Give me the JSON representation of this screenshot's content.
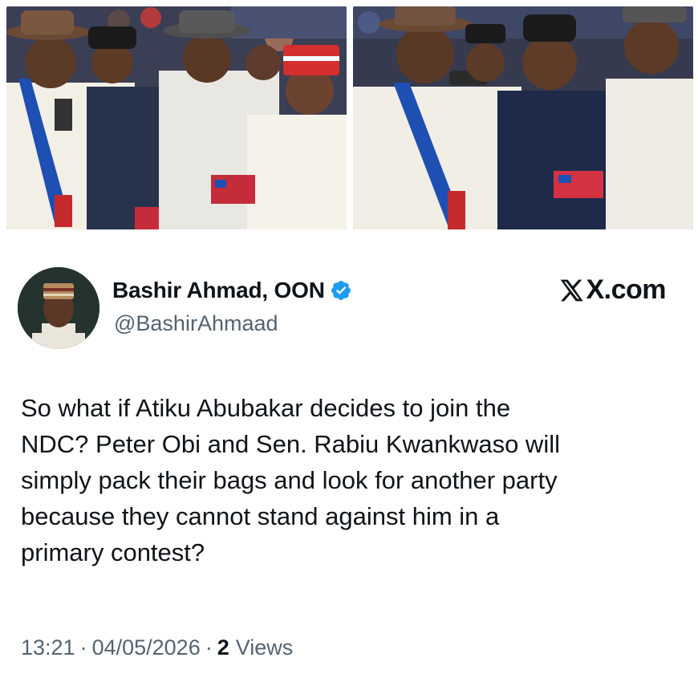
{
  "post": {
    "author": {
      "display_name": "Bashir Ahmad, OON",
      "handle": "@BashirAhmaad",
      "verified": true,
      "avatar_icon": "person-avatar"
    },
    "source": "X.com",
    "text": "So what if Atiku Abubakar decides to join the\nNDC? Peter Obi and Sen. Rabiu Kwankwaso will\nsimply pack their bags and look for another party\nbecause they cannot stand against him in a\nprimary contest?",
    "time": "13:21",
    "date": "04/05/2026",
    "separator": "·",
    "views_count": "2",
    "views_label": "Views"
  },
  "photos": [
    {
      "icon": "group-photo-left"
    },
    {
      "icon": "group-photo-right"
    }
  ],
  "colors": {
    "verified_blue": "#1d9bf0",
    "text_primary": "#0f1419",
    "text_secondary": "#536471"
  }
}
